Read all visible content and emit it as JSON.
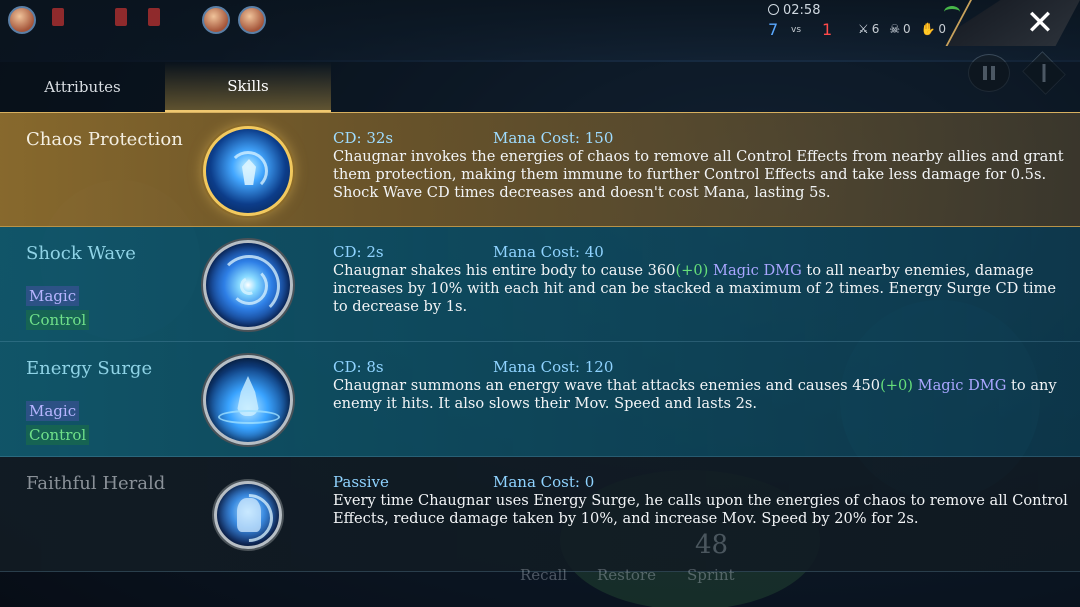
{
  "hud": {
    "time": "02:58",
    "team_blue_kills": "7",
    "vs_label": "vs",
    "team_red_kills": "1",
    "kills": "6",
    "deaths": "0",
    "assists": "0",
    "close_label": "✕"
  },
  "tabs": [
    {
      "label": "Attributes",
      "active": false
    },
    {
      "label": "Skills",
      "active": true
    }
  ],
  "skills": [
    {
      "name": "Chaos Protection",
      "cd": "CD: 32s",
      "mana": "Mana Cost: 150",
      "desc": "Chaugnar invokes the energies of chaos to remove all Control Effects from nearby allies and grant them protection, making them immune to further Control Effects and take less damage for 0.5s. Shock Wave CD times decreases and doesn't cost Mana, lasting 5s.",
      "icon": "chaos-protection-icon"
    },
    {
      "name": "Shock Wave",
      "tag1": "Magic",
      "tag2": "Control",
      "cd": "CD: 2s",
      "mana": "Mana Cost: 40",
      "desc_a": "Chaugnar shakes his entire body to cause 360",
      "desc_bonus": "(+0)",
      "desc_magic": " Magic DMG",
      "desc_b": " to all nearby enemies, damage increases by 10% with each hit and can be stacked a maximum of 2 times. Energy Surge CD time to decrease by 1s.",
      "icon": "shock-wave-icon"
    },
    {
      "name": "Energy Surge",
      "tag1": "Magic",
      "tag2": "Control",
      "cd": "CD: 8s",
      "mana": "Mana Cost: 120",
      "desc_a": "Chaugnar summons an energy wave that attacks enemies and causes 450",
      "desc_bonus": "(+0)",
      "desc_magic": " Magic DMG",
      "desc_b": " to any enemy it hits. It also slows their Mov. Speed and lasts 2s.",
      "icon": "energy-surge-icon"
    },
    {
      "name": "Faithful Herald",
      "cd": "Passive",
      "mana": "Mana Cost: 0",
      "desc": "Every time Chaugnar uses Energy Surge, he calls upon the energies of chaos to remove all Control Effects, reduce damage taken by 10%, and increase Mov. Speed by 20% for 2s.",
      "icon": "faithful-herald-icon"
    }
  ],
  "bottom": {
    "recall": "Recall",
    "restore": "Restore",
    "sprint": "Sprint",
    "number": "48"
  },
  "colors": {
    "active_row": "#927030",
    "teal_row": "#115a6e",
    "magic_tag": "#b7b5ff",
    "control_tag": "#6fe08a",
    "meta_text": "#8fd3ff"
  }
}
